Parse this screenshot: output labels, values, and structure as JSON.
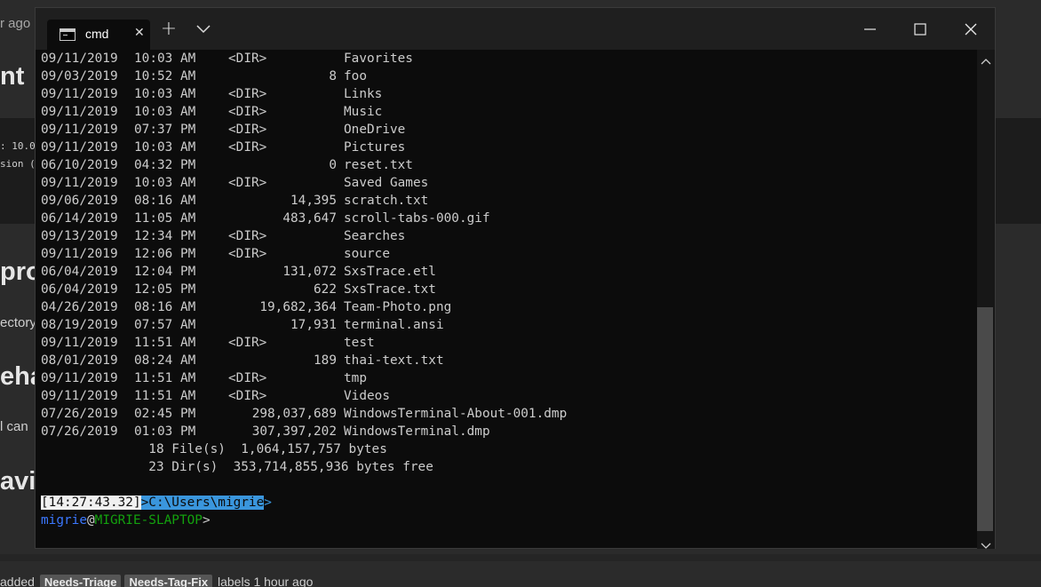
{
  "background_page": {
    "timestamp_fragment": "r ago",
    "heading_1": "nt",
    "version_line_1": ": 10.0",
    "version_line_2": "sion (",
    "heading_2": "pro",
    "text_1": "ectory",
    "heading_3": "eha",
    "text_2": "l can",
    "heading_4": "avi",
    "labels_row": {
      "prefix": "added",
      "label_1": "Needs-Triage",
      "label_2": "Needs-Tag-Fix",
      "suffix": "labels 1 hour ago"
    }
  },
  "terminal": {
    "tab_title": "cmd",
    "tab_icon": "cmd-icon",
    "close_tab_glyph": "✕",
    "new_tab_glyph": "+",
    "listing": [
      {
        "date": "09/11/2019",
        "time": "10:03 AM",
        "dir": "<DIR>",
        "size": "",
        "name": "Favorites"
      },
      {
        "date": "09/03/2019",
        "time": "10:52 AM",
        "dir": "",
        "size": "8",
        "name": "foo"
      },
      {
        "date": "09/11/2019",
        "time": "10:03 AM",
        "dir": "<DIR>",
        "size": "",
        "name": "Links"
      },
      {
        "date": "09/11/2019",
        "time": "10:03 AM",
        "dir": "<DIR>",
        "size": "",
        "name": "Music"
      },
      {
        "date": "09/11/2019",
        "time": "07:37 PM",
        "dir": "<DIR>",
        "size": "",
        "name": "OneDrive"
      },
      {
        "date": "09/11/2019",
        "time": "10:03 AM",
        "dir": "<DIR>",
        "size": "",
        "name": "Pictures"
      },
      {
        "date": "06/10/2019",
        "time": "04:32 PM",
        "dir": "",
        "size": "0",
        "name": "reset.txt"
      },
      {
        "date": "09/11/2019",
        "time": "10:03 AM",
        "dir": "<DIR>",
        "size": "",
        "name": "Saved Games"
      },
      {
        "date": "09/06/2019",
        "time": "08:16 AM",
        "dir": "",
        "size": "14,395",
        "name": "scratch.txt"
      },
      {
        "date": "06/14/2019",
        "time": "11:05 AM",
        "dir": "",
        "size": "483,647",
        "name": "scroll-tabs-000.gif"
      },
      {
        "date": "09/13/2019",
        "time": "12:34 PM",
        "dir": "<DIR>",
        "size": "",
        "name": "Searches"
      },
      {
        "date": "09/11/2019",
        "time": "12:06 PM",
        "dir": "<DIR>",
        "size": "",
        "name": "source"
      },
      {
        "date": "06/04/2019",
        "time": "12:04 PM",
        "dir": "",
        "size": "131,072",
        "name": "SxsTrace.etl"
      },
      {
        "date": "06/04/2019",
        "time": "12:05 PM",
        "dir": "",
        "size": "622",
        "name": "SxsTrace.txt"
      },
      {
        "date": "04/26/2019",
        "time": "08:16 AM",
        "dir": "",
        "size": "19,682,364",
        "name": "Team-Photo.png"
      },
      {
        "date": "08/19/2019",
        "time": "07:57 AM",
        "dir": "",
        "size": "17,931",
        "name": "terminal.ansi"
      },
      {
        "date": "09/11/2019",
        "time": "11:51 AM",
        "dir": "<DIR>",
        "size": "",
        "name": "test"
      },
      {
        "date": "08/01/2019",
        "time": "08:24 AM",
        "dir": "",
        "size": "189",
        "name": "thai-text.txt"
      },
      {
        "date": "09/11/2019",
        "time": "11:51 AM",
        "dir": "<DIR>",
        "size": "",
        "name": "tmp"
      },
      {
        "date": "09/11/2019",
        "time": "11:51 AM",
        "dir": "<DIR>",
        "size": "",
        "name": "Videos"
      },
      {
        "date": "07/26/2019",
        "time": "02:45 PM",
        "dir": "",
        "size": "298,037,689",
        "name": "WindowsTerminal-About-001.dmp"
      },
      {
        "date": "07/26/2019",
        "time": "01:03 PM",
        "dir": "",
        "size": "307,397,202",
        "name": "WindowsTerminal.dmp"
      }
    ],
    "summary_files": "              18 File(s)  1,064,157,757 bytes",
    "summary_dirs": "              23 Dir(s)  353,714,855,936 bytes free",
    "prompt": {
      "time": "[14:27:43.32]",
      "path": ">C:\\Users\\migrie",
      "arrow": ">"
    },
    "user_line": {
      "user": "migrie",
      "at": "@",
      "host": "MIGRIE-SLAPTOP",
      "gt": ">"
    },
    "colors": {
      "background": "#0c0c0c",
      "foreground": "#cccccc",
      "prompt_path_bg": "#3a96dd",
      "user": "#3b78ff",
      "host": "#13a10e"
    }
  }
}
